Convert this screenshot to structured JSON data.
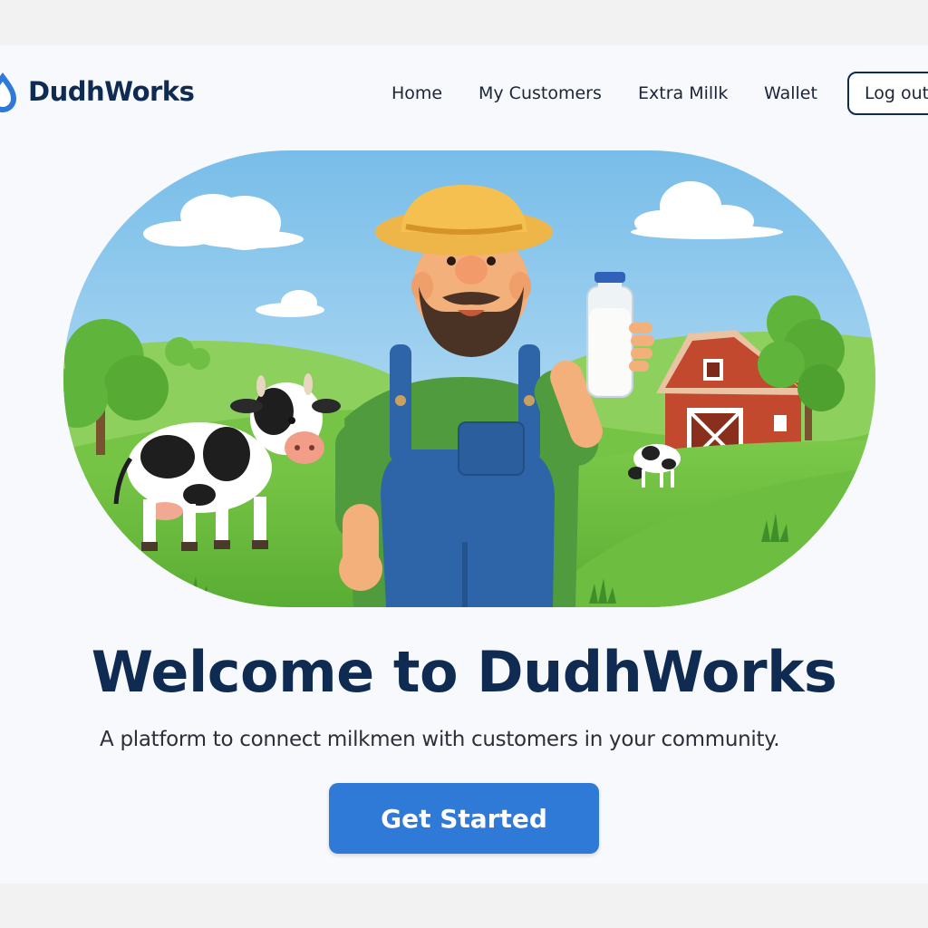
{
  "header": {
    "brand": "DudhWorks",
    "nav": [
      {
        "label": "Home"
      },
      {
        "label": "My Customers"
      },
      {
        "label": "Extra Millk"
      },
      {
        "label": "Wallet"
      }
    ],
    "logout_label": "Log out"
  },
  "hero": {
    "title": "Welcome to DudhWorks",
    "subtitle": "A platform to connect milkmen with customers in your community.",
    "cta_label": "Get Started"
  },
  "colors": {
    "brand_navy": "#0f2b52",
    "primary_button": "#2f7ad6",
    "page_background": "#f7f9fc"
  },
  "icons": [
    "milk-drop-logo-icon"
  ]
}
